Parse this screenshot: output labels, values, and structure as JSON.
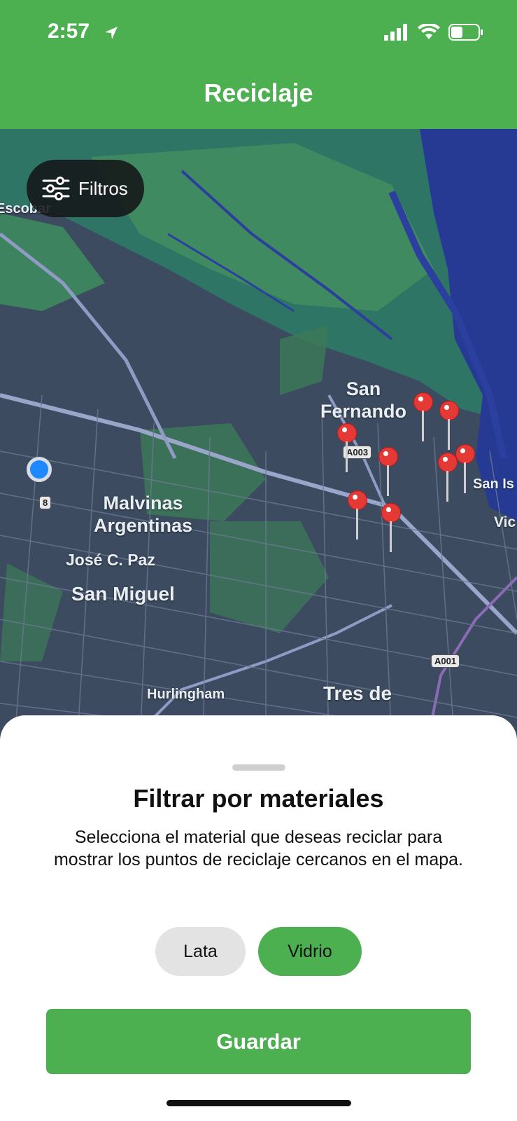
{
  "status_bar": {
    "time": "2:57"
  },
  "header": {
    "title": "Reciclaje"
  },
  "map": {
    "filters_label": "Filtros",
    "labels": {
      "escobar": "Escobar",
      "san_fernando": "San\nFernando",
      "malvinas": "Malvinas\nArgentinas",
      "jose_c_paz": "José C. Paz",
      "san_miguel": "San Miguel",
      "hurlingham": "Hurlingham",
      "tres_de": "Tres de",
      "san_is": "San Is",
      "vic": "Vic"
    },
    "shields": {
      "route8": "8",
      "a003": "A003",
      "a001": "A001"
    }
  },
  "sheet": {
    "title": "Filtrar por materiales",
    "description": "Selecciona el material que deseas reciclar para mostrar los puntos de reciclaje cercanos en el mapa.",
    "chips": [
      {
        "label": "Lata",
        "selected": false
      },
      {
        "label": "Vidrio",
        "selected": true
      }
    ],
    "save_label": "Guardar"
  },
  "colors": {
    "accent": "#4caf50",
    "pin": "#e53935",
    "user_location": "#1e88ff"
  }
}
